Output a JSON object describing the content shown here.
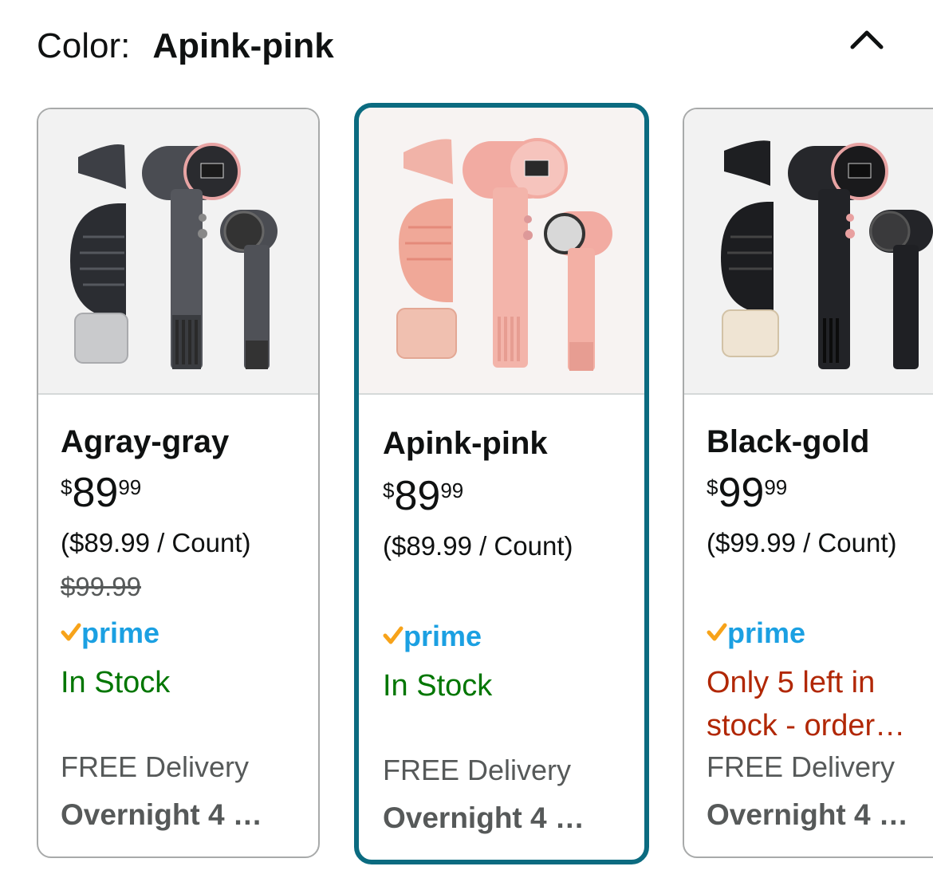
{
  "header": {
    "label": "Color:",
    "selected": "Apink-pink",
    "collapse_icon": "chevron-up-icon"
  },
  "colors": {
    "selected_border": "#0b6b80",
    "in_stock": "#007600",
    "low_stock": "#b12704",
    "prime_blue": "#1ba0e2",
    "prime_check": "#f7a31a"
  },
  "variants": [
    {
      "name": "Agray-gray",
      "price_symbol": "$",
      "price_whole": "89",
      "price_fraction": "99",
      "unit_price": "($89.99 / Count)",
      "list_price": "$99.99",
      "prime": "prime",
      "stock": "In Stock",
      "delivery_label": "FREE Delivery",
      "delivery_time": "Overnight 4 …",
      "selected": false,
      "product_color": "gray"
    },
    {
      "name": "Apink-pink",
      "price_symbol": "$",
      "price_whole": "89",
      "price_fraction": "99",
      "unit_price": "($89.99 / Count)",
      "prime": "prime",
      "stock": "In Stock",
      "delivery_label": "FREE Delivery",
      "delivery_time": "Overnight 4 …",
      "selected": true,
      "product_color": "pink"
    },
    {
      "name": "Black-gold",
      "price_symbol": "$",
      "price_whole": "99",
      "price_fraction": "99",
      "unit_price": "($99.99 / Count)",
      "prime": "prime",
      "stock_line1": "Only 5 left in",
      "stock_line2": "stock - order…",
      "delivery_label": "FREE Delivery",
      "delivery_time": "Overnight 4 …",
      "selected": false,
      "product_color": "black"
    }
  ]
}
